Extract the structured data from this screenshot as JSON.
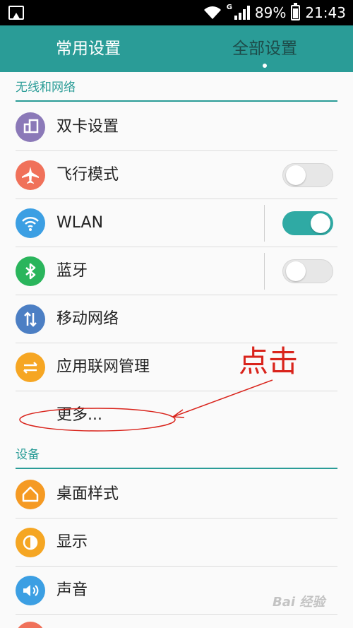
{
  "status_bar": {
    "network_type": "G",
    "battery_percent": "89%",
    "time": "21:43",
    "icons": [
      "picture-icon",
      "wifi-icon",
      "signal-icon",
      "battery-icon"
    ]
  },
  "tabs": [
    {
      "label": "常用设置",
      "selected": false
    },
    {
      "label": "全部设置",
      "selected": true
    }
  ],
  "sections": [
    {
      "title": "无线和网络",
      "items": [
        {
          "label": "双卡设置",
          "icon": "dual-sim-icon",
          "color": "#8b79b8"
        },
        {
          "label": "飞行模式",
          "icon": "airplane-icon",
          "color": "#f0715a",
          "toggle": "off"
        },
        {
          "label": "WLAN",
          "icon": "wifi-icon",
          "color": "#3c9fe3",
          "toggle": "on"
        },
        {
          "label": "蓝牙",
          "icon": "bluetooth-icon",
          "color": "#2ab55c",
          "toggle": "off"
        },
        {
          "label": "移动网络",
          "icon": "mobile-data-icon",
          "color": "#4c7fc4"
        },
        {
          "label": "应用联网管理",
          "icon": "app-network-icon",
          "color": "#f6a623"
        },
        {
          "label": "更多..."
        }
      ]
    },
    {
      "title": "设备",
      "items": [
        {
          "label": "桌面样式",
          "icon": "home-icon",
          "color": "#f59a23"
        },
        {
          "label": "显示",
          "icon": "display-icon",
          "color": "#f5a623"
        },
        {
          "label": "声音",
          "icon": "sound-icon",
          "color": "#3c9fe3"
        }
      ]
    }
  ],
  "annotation": {
    "text": "点击",
    "color": "#d9241c"
  },
  "watermark": {
    "text": "Bai 经验"
  },
  "colors": {
    "accent": "#2a9c97",
    "toggle_on": "#2faaa4"
  }
}
